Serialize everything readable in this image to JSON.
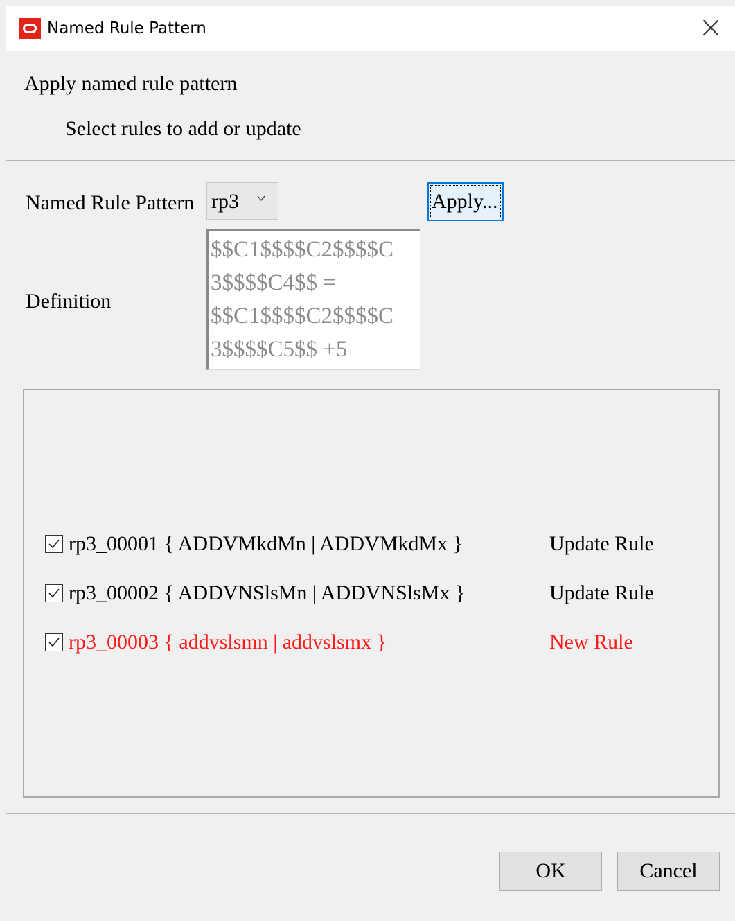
{
  "window": {
    "title": "Named Rule Pattern",
    "icon": "oracle-logo-icon",
    "close_icon": "close-icon"
  },
  "header": {
    "title": "Apply named rule pattern",
    "subtitle": "Select rules to add or update"
  },
  "form": {
    "pattern_label": "Named Rule Pattern",
    "pattern_value": "rp3",
    "apply_label": "Apply...",
    "definition_label": "Definition",
    "definition_lines": [
      "$$C1$$$$C2$$$$C",
      "3$$$$C4$$ =",
      "$$C1$$$$C2$$$$C",
      "3$$$$C5$$ +5"
    ]
  },
  "rules": [
    {
      "checked": true,
      "label": "rp3_00001 { ADDVMkdMn | ADDVMkdMx }",
      "action": "Update Rule"
    },
    {
      "checked": true,
      "label": "rp3_00002 { ADDVNSlsMn | ADDVNSlsMx }",
      "action": "Update Rule"
    },
    {
      "checked": true,
      "label": "rp3_00003 { addvslsmn | addvslsmx }",
      "action": "New Rule"
    }
  ],
  "footer": {
    "ok_label": "OK",
    "cancel_label": "Cancel"
  },
  "colors": {
    "new_rule": "#ff1a1a",
    "focus_border": "#0078d7",
    "brand": "#e2231a"
  }
}
